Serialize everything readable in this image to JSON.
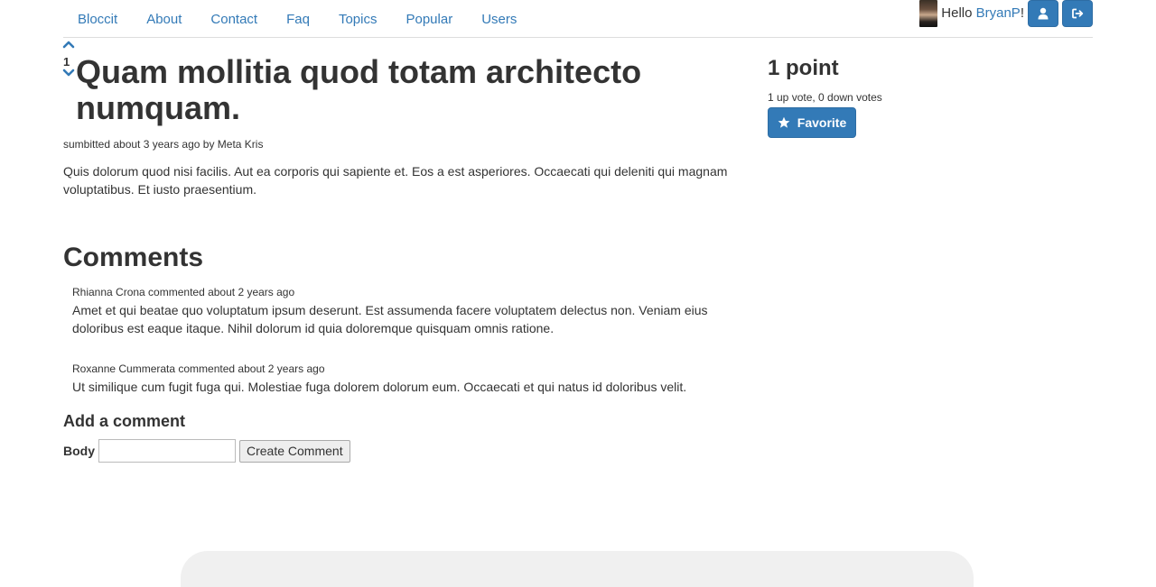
{
  "nav": {
    "links": [
      "Bloccit",
      "About",
      "Contact",
      "Faq",
      "Topics",
      "Popular",
      "Users"
    ]
  },
  "user": {
    "hello_prefix": "Hello ",
    "name": "BryanP",
    "hello_suffix": "!",
    "profile_icon": "user-icon",
    "signout_icon": "sign-out-icon"
  },
  "post": {
    "vote_count": "1",
    "title": "Quam mollitia quod totam architecto numquam.",
    "submitted": "sumbitted about 3 years ago by Meta Kris",
    "body": "Quis dolorum quod nisi facilis. Aut ea corporis qui sapiente et. Eos a est asperiores. Occaecati qui deleniti qui magnam voluptatibus. Et iusto praesentium."
  },
  "sidebar": {
    "points": "1 point",
    "votes_summary": "1 up vote, 0 down votes",
    "favorite_label": "Favorite",
    "favorite_icon": "star-icon"
  },
  "comments": {
    "heading": "Comments",
    "items": [
      {
        "meta": "Rhianna Crona commented about 2 years ago",
        "text": "Amet et qui beatae quo voluptatum ipsum deserunt. Est assumenda facere voluptatem delectus non. Veniam eius doloribus est eaque itaque. Nihil dolorum id quia doloremque quisquam omnis ratione."
      },
      {
        "meta": "Roxanne Cummerata commented about 2 years ago",
        "text": "Ut similique cum fugit fuga qui. Molestiae fuga dolorem dolorum eum. Occaecati et qui natus id doloribus velit."
      }
    ]
  },
  "add_comment": {
    "heading": "Add a comment",
    "body_label": "Body",
    "body_value": "",
    "submit_label": "Create Comment"
  },
  "colors": {
    "link": "#337ab7",
    "button": "#337ab7",
    "text": "#333333"
  }
}
